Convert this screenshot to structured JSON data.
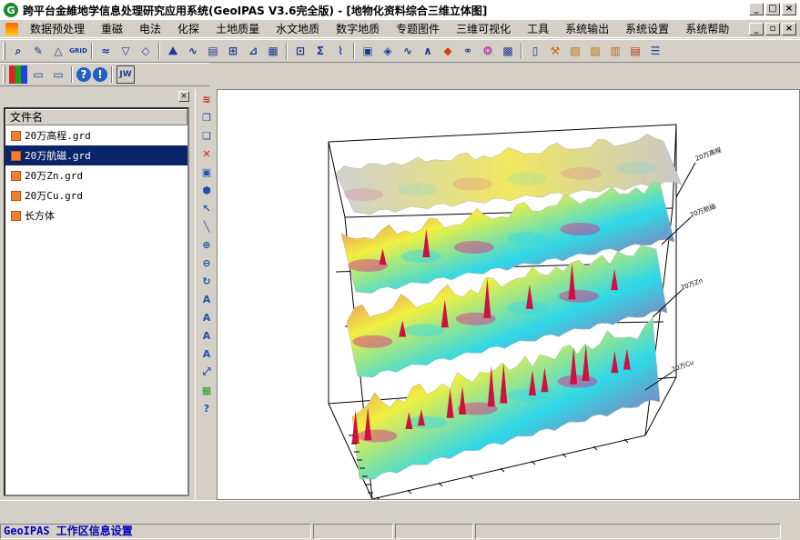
{
  "window": {
    "title": "跨平台金維地学信息处理研究应用系统(GeoIPAS V3.6完全版) - [地物化资料综合三维立体图]",
    "icon": "geo-logo-icon",
    "controls": [
      "minimize-icon",
      "maximize-icon",
      "close-icon"
    ]
  },
  "menu": {
    "items": [
      "数据预处理",
      "重磁",
      "电法",
      "化探",
      "土地质量",
      "水文地质",
      "数字地质",
      "专题图件",
      "三维可视化",
      "工具",
      "系统输出",
      "系统设置",
      "系统帮助"
    ]
  },
  "toolbar1": {
    "icons": [
      "search-icon",
      "edit-icon",
      "triangle-icon",
      "grid-icon",
      "contour-icon",
      "filter-icon",
      "wave-icon",
      "map-icon",
      "chart-icon",
      "layers-icon",
      "table-icon",
      "axis-icon",
      "matrix-icon",
      "frame-icon",
      "calc-icon",
      "zigzag-icon",
      "peak-icon",
      "color-icon",
      "venn-icon",
      "globe-icon",
      "mosaic-icon",
      "doc-icon",
      "brush-icon",
      "note-icon",
      "export-icon",
      "pipe-icon",
      "copy-icon"
    ],
    "grid_label": "GRID"
  },
  "toolbar2": {
    "icons": [
      "palette-icon",
      "doc-icon",
      "doc-back-icon",
      "help-icon",
      "info-icon"
    ],
    "jw_label": "JW"
  },
  "left_panel": {
    "column_header": "文件名",
    "files": [
      "20万高程.grd",
      "20万航磁.grd",
      "20万Zn.grd",
      "20万Cu.grd",
      "长方体"
    ],
    "selected_index": 1
  },
  "side_tools": [
    "layers-icon",
    "copy-icon",
    "paste-icon",
    "delete-icon",
    "image-icon",
    "cube-icon",
    "pointer-icon",
    "line-icon",
    "zoom-in-icon",
    "zoom-out-icon",
    "rotate-icon",
    "text-icon",
    "text-bold-icon",
    "text-edit-icon",
    "text-select-icon",
    "fit-icon",
    "color-grid-icon",
    "help-icon"
  ],
  "plot": {
    "layer_labels": [
      "20万高程",
      "20万航磁",
      "20万Zn",
      "20万Cu"
    ],
    "colors": {
      "magenta": "#e0208a",
      "cyan": "#30d8e8",
      "yellow": "#f0f040",
      "red": "#d01040",
      "white": "#ffffff"
    }
  },
  "status": {
    "text": "GeoIPAS 工作区信息设置"
  }
}
